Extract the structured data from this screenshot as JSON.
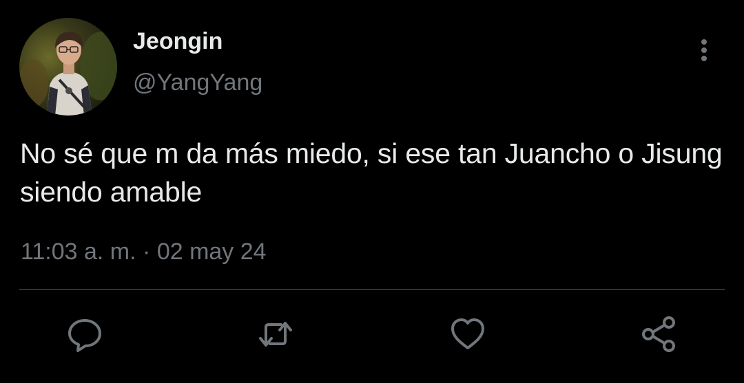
{
  "tweet": {
    "author": {
      "display_name": "Jeongin",
      "handle": "@YangYang",
      "avatar_icon": "avatar-photo"
    },
    "text": "No sé que m da más miedo, si ese tan Juancho o Jisung siendo amable",
    "time": "11:03 a. m.",
    "separator": "·",
    "date": "02 may 24"
  },
  "actions": [
    {
      "icon": "reply-icon"
    },
    {
      "icon": "retweet-icon"
    },
    {
      "icon": "like-icon"
    },
    {
      "icon": "share-icon"
    }
  ],
  "menu": {
    "icon": "more-vertical-icon"
  },
  "colors": {
    "background": "#000000",
    "text_primary": "#e7e9ea",
    "text_secondary": "#71767b",
    "divider": "#2f3336"
  }
}
